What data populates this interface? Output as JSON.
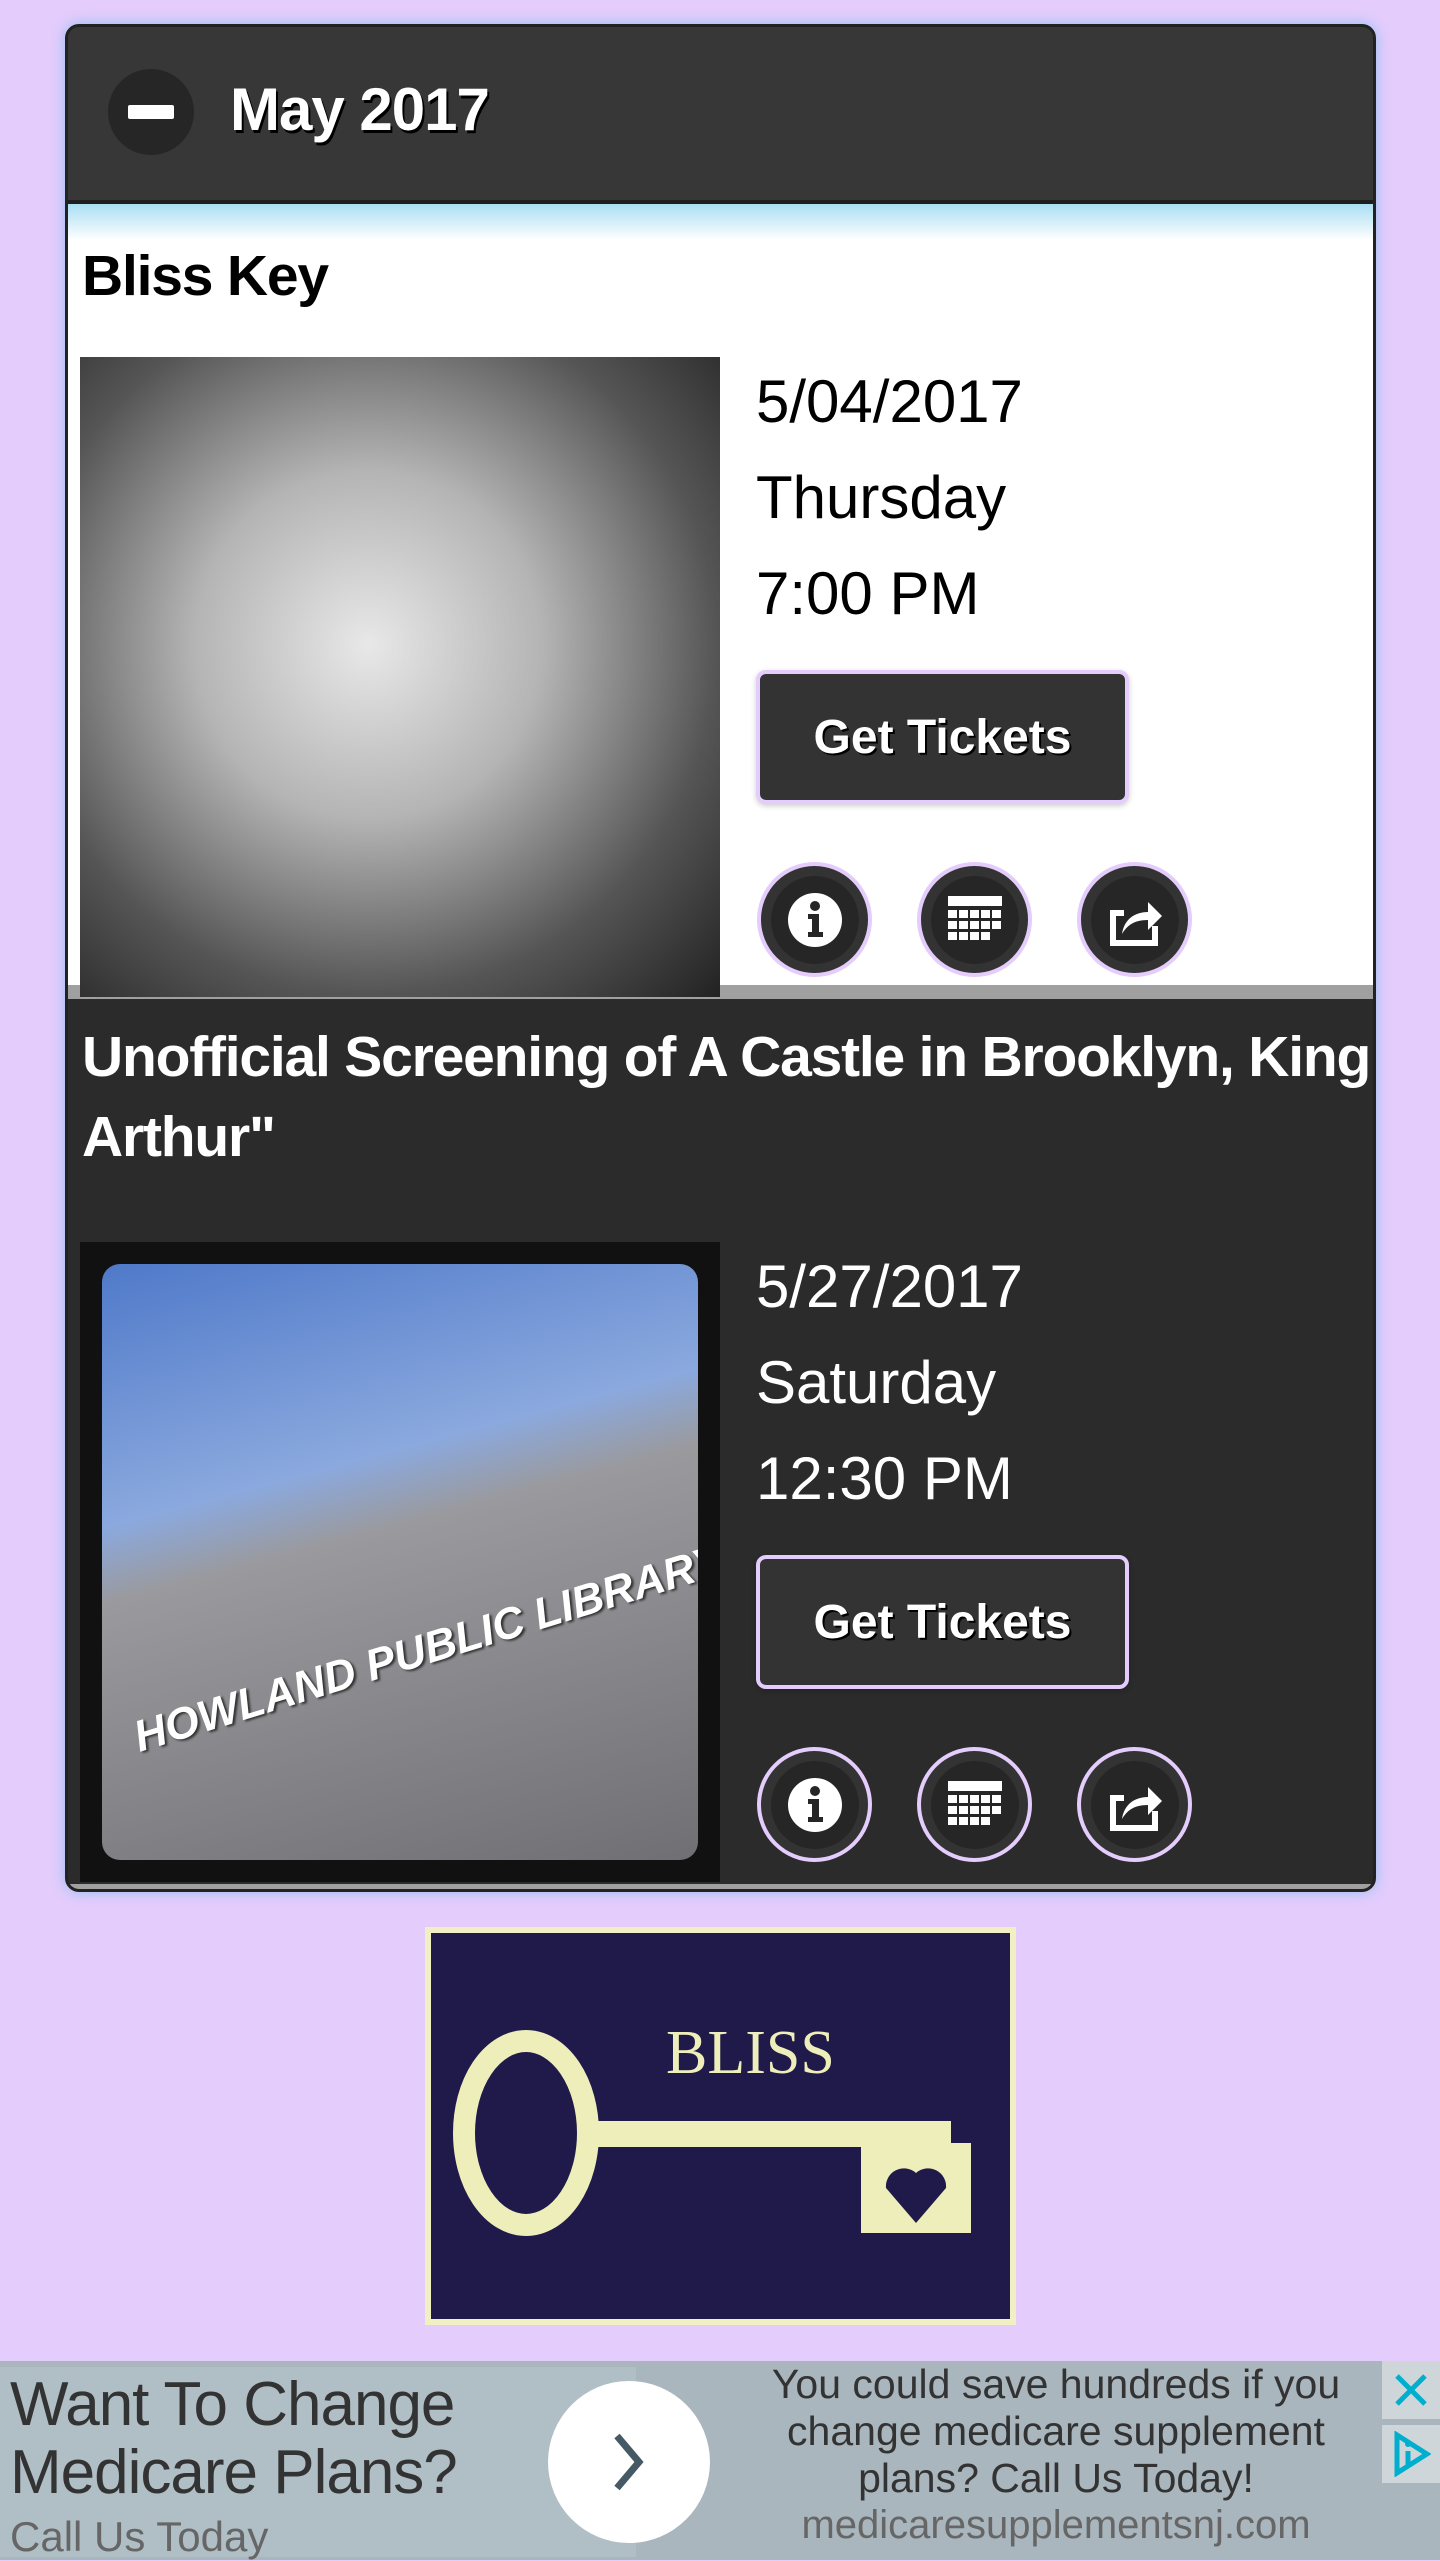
{
  "month_header": {
    "title": "May 2017",
    "collapse_icon": "minus-icon"
  },
  "events": [
    {
      "title": "Bliss Key",
      "date": "5/04/2017",
      "weekday": "Thursday",
      "time": "7:00 PM",
      "button": "Get Tickets"
    },
    {
      "title": "Unofficial Screening of A Castle in Brooklyn, King Arthur\"",
      "date": "5/27/2017",
      "weekday": "Saturday",
      "time": "12:30 PM",
      "button": "Get Tickets",
      "image_text": "HOWLAND PUBLIC LIBRARY"
    }
  ],
  "action_icons": [
    "info-icon",
    "calendar-icon",
    "share-icon"
  ],
  "logo": {
    "text": "BLISS"
  },
  "ad": {
    "headline": "Want To Change Medicare Plans?",
    "subline": "Call Us Today",
    "body": "You could save hundreds if you change medicare supplement plans? Call Us Today!",
    "url": "medicaresupplementsnj.com",
    "accent": "#00aecd"
  }
}
